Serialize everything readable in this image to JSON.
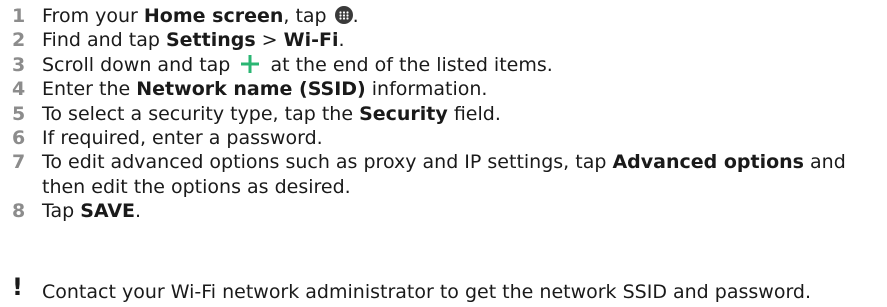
{
  "steps": [
    {
      "num": "1",
      "pre": "From your ",
      "bold": "Home screen",
      "post": ", tap ",
      "icon": "apps-grid-icon",
      "end": "."
    },
    {
      "num": "2",
      "pre": "Find and tap ",
      "bold1": "Settings",
      "mid": " > ",
      "bold2": "Wi-Fi",
      "end": "."
    },
    {
      "num": "3",
      "pre": "Scroll down and tap ",
      "icon": "plus-icon",
      "post": " at the end of the listed items.",
      "icon_color": "#2bb673"
    },
    {
      "num": "4",
      "pre": "Enter the ",
      "bold": "Network name (SSID)",
      "post": " information."
    },
    {
      "num": "5",
      "pre": "To select a security type, tap the ",
      "bold": "Security",
      "post": " field."
    },
    {
      "num": "6",
      "text": "If required, enter a password."
    },
    {
      "num": "7",
      "pre": "To edit advanced options such as proxy and IP settings, tap ",
      "bold": "Advanced options",
      "post": " and then edit the options as desired."
    },
    {
      "num": "8",
      "pre": "Tap ",
      "bold": "SAVE",
      "post": "."
    }
  ],
  "note": {
    "icon": "exclamation-icon",
    "symbol": "!",
    "text": "Contact your Wi-Fi network administrator to get the network SSID and password."
  }
}
